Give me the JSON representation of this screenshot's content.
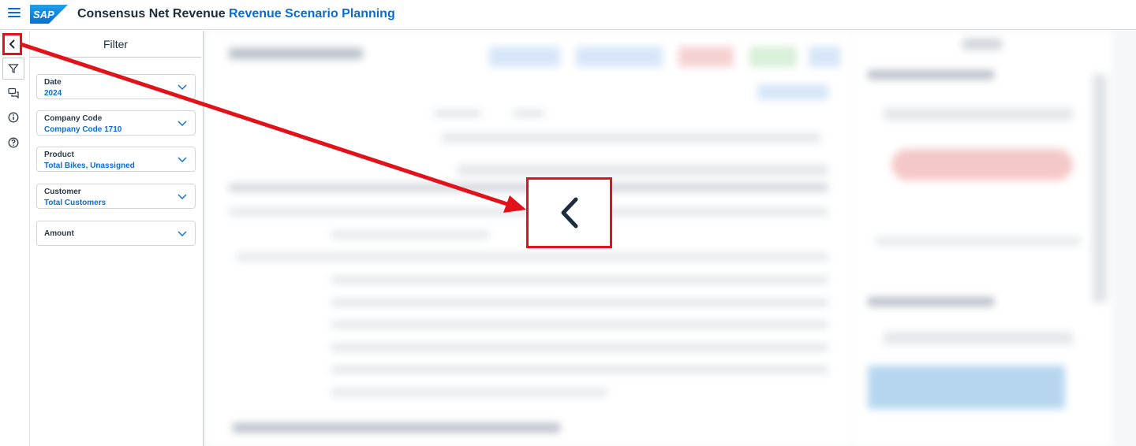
{
  "header": {
    "app_title": "Consensus Net Revenue",
    "page_title": "Revenue Scenario Planning",
    "logo_text": "SAP"
  },
  "rail": {
    "icons": [
      "collapse-icon",
      "filter-icon",
      "comments-icon",
      "info-icon",
      "help-icon"
    ]
  },
  "filter": {
    "title": "Filter",
    "fields": [
      {
        "label": "Date",
        "value": "2024"
      },
      {
        "label": "Company Code",
        "value": "Company Code 1710"
      },
      {
        "label": "Product",
        "value": "Total Bikes, Unassigned"
      },
      {
        "label": "Customer",
        "value": "Total Customers"
      },
      {
        "label": "Amount",
        "value": ""
      }
    ]
  },
  "colors": {
    "accent": "#0a6ed1",
    "annotation": "#e2121b",
    "text": "#1d2d3e"
  }
}
